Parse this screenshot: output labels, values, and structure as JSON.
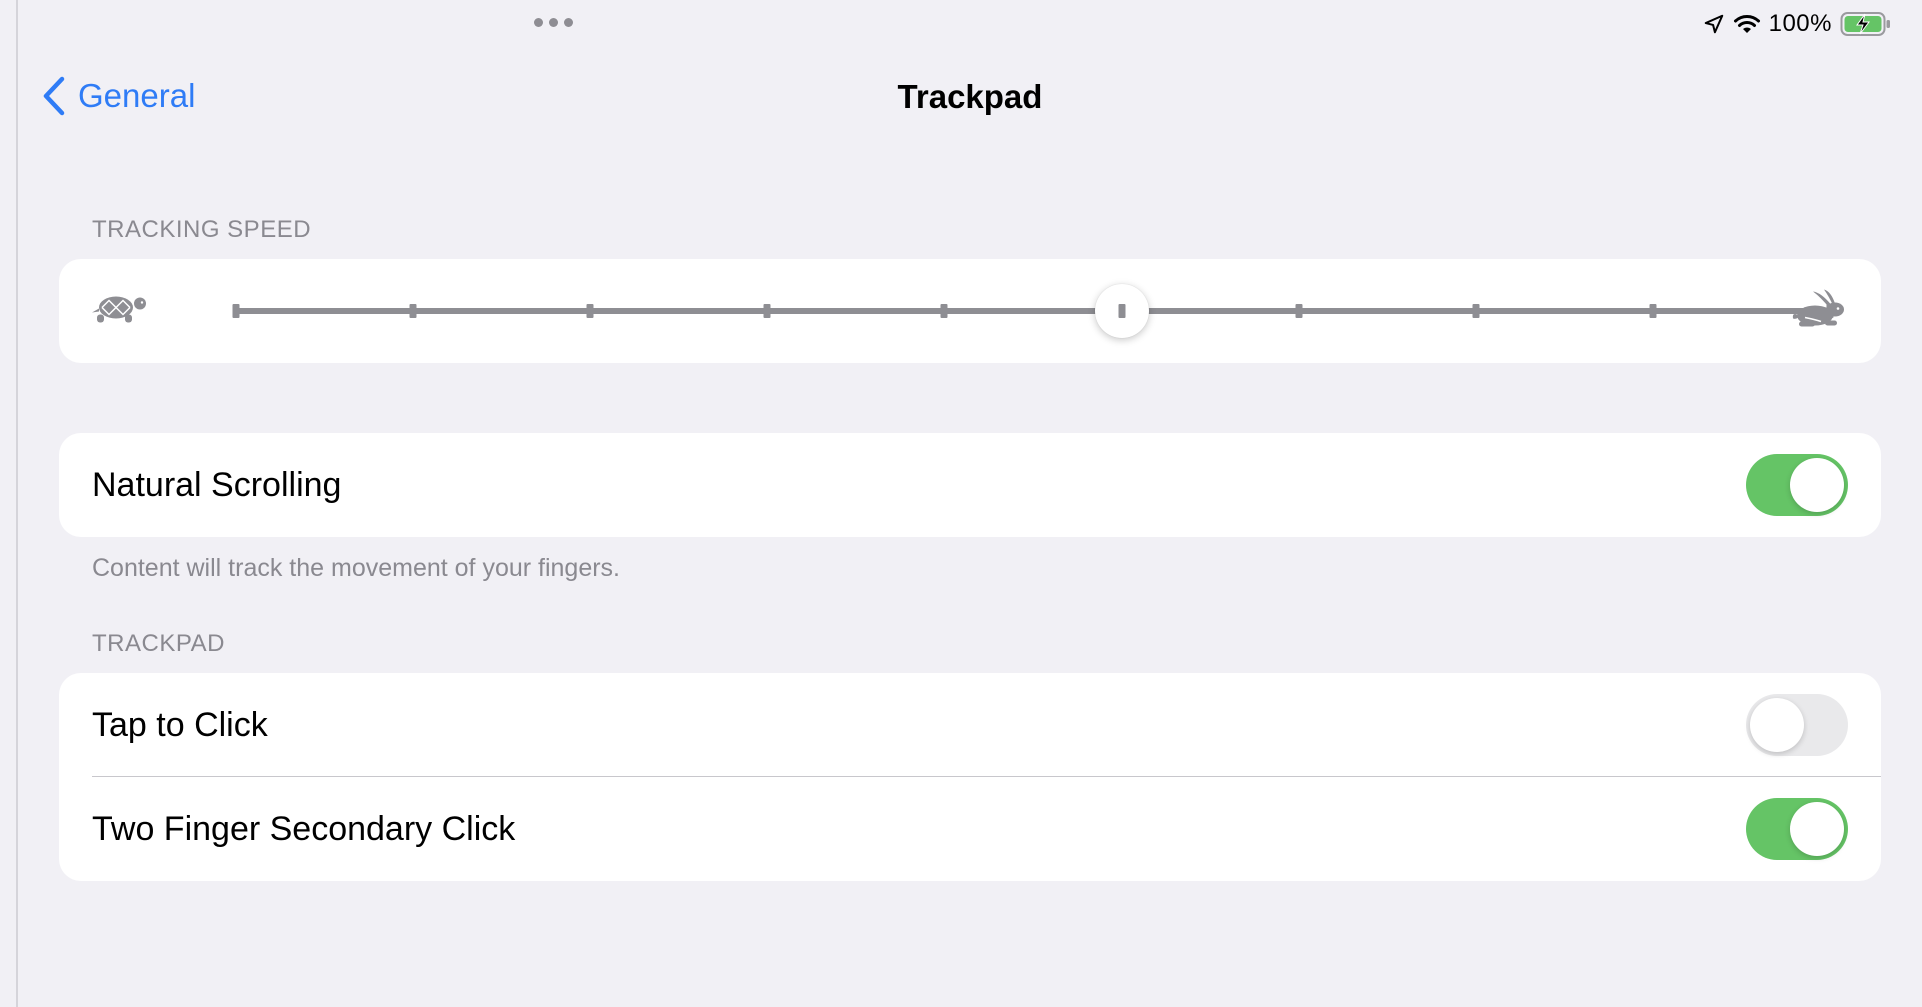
{
  "status_bar": {
    "battery_percent": "100%",
    "icons": [
      "location-icon",
      "wifi-icon",
      "battery-charging-icon"
    ]
  },
  "nav": {
    "back_label": "General",
    "title": "Trackpad"
  },
  "tracking_speed": {
    "header": "TRACKING SPEED",
    "slider_value": 5,
    "slider_steps": 9,
    "min_icon": "turtle-icon",
    "max_icon": "rabbit-icon"
  },
  "natural_scrolling": {
    "label": "Natural Scrolling",
    "on": true,
    "footer": "Content will track the movement of your fingers."
  },
  "trackpad_section": {
    "header": "TRACKPAD",
    "rows": [
      {
        "label": "Tap to Click",
        "on": false
      },
      {
        "label": "Two Finger Secondary Click",
        "on": true
      }
    ]
  },
  "colors": {
    "accent": "#2f7cf6",
    "toggle_on": "#65c466",
    "toggle_off": "#e9e9eb",
    "background": "#f1f0f5"
  }
}
